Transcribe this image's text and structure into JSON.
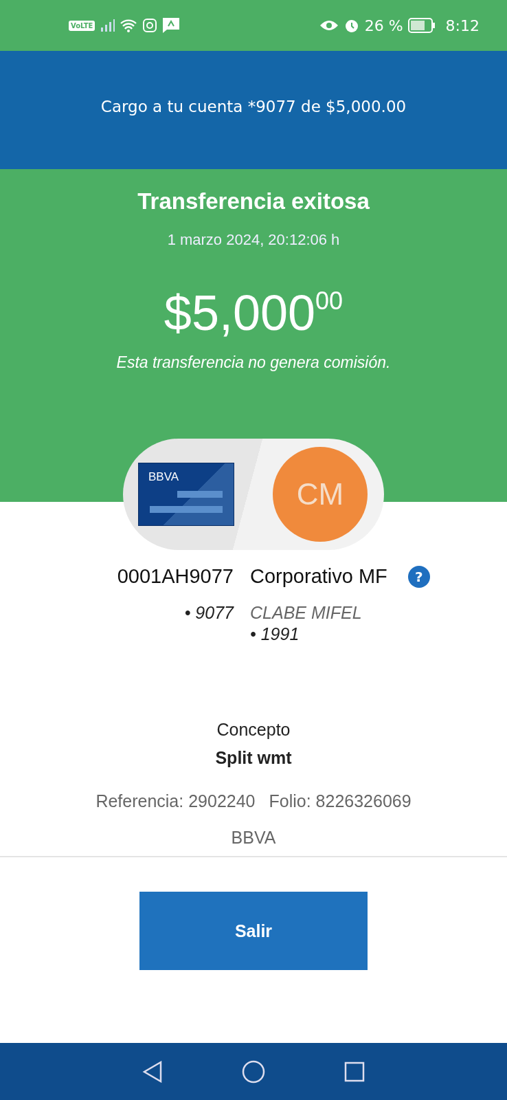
{
  "status_bar": {
    "network_badge": "VoLTE",
    "battery_percent": "26 %",
    "time": "8:12"
  },
  "banner": {
    "text": "Cargo a tu cuenta *9077 de $5,000.00"
  },
  "result": {
    "title": "Transferencia exitosa",
    "date": "1 marzo 2024, 20:12:06 h",
    "amount": "$5,000$^{00}$",
    "note": "Esta transferencia no genera comisión."
  },
  "origin": {
    "card_brand": "BBVA",
    "account": "0001AH9077",
    "detail": "• 9077"
  },
  "destination": {
    "initials": "CM",
    "name": "Corporativo MF",
    "help": "?",
    "bank": "CLABE MIFEL",
    "detail": "• 1991"
  },
  "concept": {
    "label": "Concepto",
    "value": "Split wmt"
  },
  "reference": "Referencia: 2902240",
  "folio": "Folio: 8226326069",
  "bank": "BBVA",
  "exit_button": "Salir"
}
